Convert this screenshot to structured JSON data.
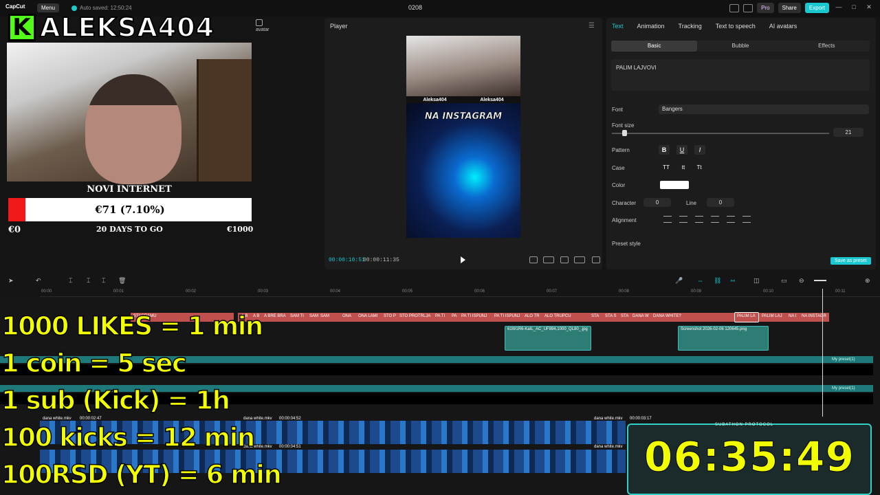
{
  "titlebar": {
    "app_name": "CapCut",
    "menu_label": "Menu",
    "autosave": "Auto saved: 12:50:24",
    "project_name": "0208",
    "pro_label": "Pro",
    "share_label": "Share",
    "export_label": "Export",
    "accent": "#19c8d1"
  },
  "overlay": {
    "kick_badge": "K",
    "streamer_name": "ALEKSA404",
    "goal_title": "NOVI INTERNET",
    "goal_amount": "€71 (7.10%)",
    "goal_progress": 0.071,
    "goal_min": "€0",
    "goal_days": "20 DAYS TO GO",
    "goal_max": "€1000",
    "rules": [
      "1000 LIKES = 1 min",
      "1 coin = 5 sec",
      "1 sub (Kick) = 1h",
      "100 kicks = 12 min",
      "100RSD (YT) = 6 min"
    ],
    "timer_label": "SUBATHON PROTOCOL",
    "timer_value": "06:35:49"
  },
  "media_panel": {
    "avatar_label": "avatar"
  },
  "player": {
    "title": "Player",
    "strip_left": "Aleksa404",
    "strip_right": "Aleksa404",
    "caption": "NA INSTAGRAM",
    "current_time": "00:00:10:51",
    "total_time": "00:00:11:35"
  },
  "properties": {
    "tabs": [
      "Text",
      "Animation",
      "Tracking",
      "Text to speech",
      "AI avatars"
    ],
    "subtabs": [
      "Basic",
      "Bubble",
      "Effects"
    ],
    "text_value": "PALIM LAJVOVI",
    "font_label": "Font",
    "font_value": "Bangers",
    "font_size_label": "Font size",
    "font_size_value": "21",
    "pattern_label": "Pattern",
    "pattern_buttons": [
      "B",
      "U",
      "I"
    ],
    "case_label": "Case",
    "case_buttons": [
      "TT",
      "tt",
      "Tt"
    ],
    "color_label": "Color",
    "color_value": "#ffffff",
    "character_label": "Character",
    "character_value": "0",
    "line_label": "Line",
    "line_value": "0",
    "alignment_label": "Alignment",
    "preset_style_label": "Preset style",
    "save_preset_label": "Save as preset"
  },
  "timeline": {
    "ruler": [
      "00:00",
      "00:01",
      "00:02",
      "00:03",
      "00:04",
      "00:05",
      "00:06",
      "00:07",
      "00:08",
      "00:09",
      "00:10",
      "00:11"
    ],
    "text_clips": [
      "STAGRAMU",
      "A B",
      "A B",
      "A BRE BRA",
      "SAM TI",
      "SAM",
      "SAM",
      "ONA",
      "ONA LAMI",
      "STO P",
      "STO PROTRLJA",
      "PA TI",
      "PA",
      "PA TI ISPUNJ",
      "PA TI ISPUNJ",
      "ALO TR",
      "ALO TRUPCU",
      "STA",
      "STA S",
      "STA",
      "DANA W",
      "DANA WHITE?",
      "PALIM LA",
      "PALIM LAJ",
      "NA I",
      "NA INSTAGR"
    ],
    "image_clip_1": "61W1R6-KaIL_AC_UF894,1000_QL80_.jpg",
    "image_clip_2": "Screenshot 2026-02-06 120645.png",
    "preset_tag": "My preset(1)",
    "video_1_name": "dana white.mkv",
    "video_1_dur": "00:00:02:47",
    "video_2_name": "dana white.mkv",
    "video_2_dur": "00:00:04:52",
    "video_3_name": "dana white.mkv",
    "video_3_dur": "00:00:03:17",
    "video_4_name": "dana white.mkv",
    "video_4_dur": "00:00:04:51",
    "video_5_name": "dana white.mkv"
  }
}
